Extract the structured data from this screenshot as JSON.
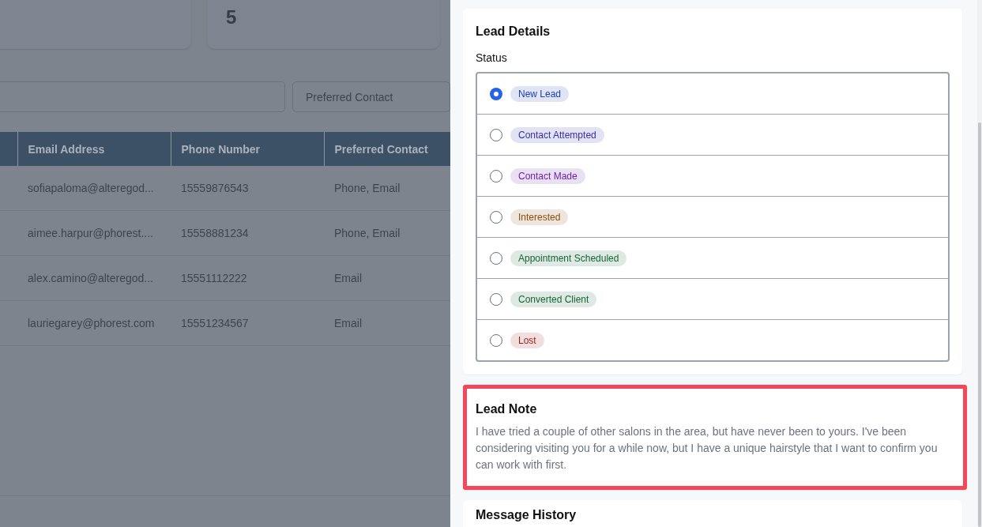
{
  "summary_cards": [
    {
      "value": "5"
    }
  ],
  "filters": {
    "preferred_contact": {
      "placeholder": "Preferred Contact"
    }
  },
  "table": {
    "columns": [
      "Email Address",
      "Phone Number",
      "Preferred Contact"
    ],
    "rows": [
      [
        "sofiapaloma@alteregod...",
        "15559876543",
        "Phone, Email"
      ],
      [
        "aimee.harpur@phorest....",
        "15558881234",
        "Phone, Email"
      ],
      [
        "alex.camino@alteregod...",
        "15551112222",
        "Email"
      ],
      [
        "lauriegarey@phorest.com",
        "15551234567",
        "Email"
      ]
    ]
  },
  "lead_details": {
    "title": "Lead Details",
    "status_label": "Status",
    "statuses": [
      {
        "label": "New Lead",
        "selected": true,
        "color": "#1e40af"
      },
      {
        "label": "Contact Attempted",
        "selected": false,
        "color": "#3730a3"
      },
      {
        "label": "Contact Made",
        "selected": false,
        "color": "#6b21a8"
      },
      {
        "label": "Interested",
        "selected": false,
        "color": "#854d0e"
      },
      {
        "label": "Appointment Scheduled",
        "selected": false,
        "color": "#166534"
      },
      {
        "label": "Converted Client",
        "selected": false,
        "color": "#166534"
      },
      {
        "label": "Lost",
        "selected": false,
        "color": "#991b1b"
      }
    ]
  },
  "lead_note": {
    "title": "Lead Note",
    "highlighted": true,
    "text": "I have tried a couple of other salons in the area, but have never been to yours. I've been considering visiting you for a while now, but I have a unique hairstyle that I want to confirm you can work with first."
  },
  "message_history": {
    "title": "Message History"
  }
}
